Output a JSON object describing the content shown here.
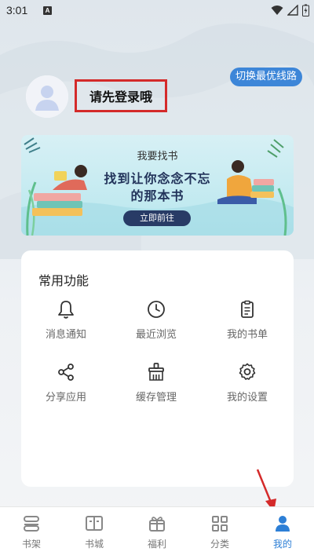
{
  "status_bar": {
    "time": "3:01",
    "notification_letter": "A"
  },
  "header": {
    "switch_line_label": "切换最优线路",
    "login_hint": "请先登录哦"
  },
  "banner": {
    "title": "我要找书",
    "slogan_line1": "找到让你念念不忘",
    "slogan_line2": "的那本书",
    "button_label": "立即前往"
  },
  "functions": {
    "title": "常用功能",
    "items": [
      {
        "label": "消息通知",
        "icon": "bell-icon"
      },
      {
        "label": "最近浏览",
        "icon": "clock-icon"
      },
      {
        "label": "我的书单",
        "icon": "clipboard-icon"
      },
      {
        "label": "分享应用",
        "icon": "share-icon"
      },
      {
        "label": "缓存管理",
        "icon": "broom-icon"
      },
      {
        "label": "我的设置",
        "icon": "gear-icon"
      }
    ]
  },
  "tabs": [
    {
      "label": "书架",
      "icon": "bookshelf-icon"
    },
    {
      "label": "书城",
      "icon": "book-icon"
    },
    {
      "label": "福利",
      "icon": "gift-icon"
    },
    {
      "label": "分类",
      "icon": "grid-icon"
    },
    {
      "label": "我的",
      "icon": "user-icon",
      "active": true
    }
  ],
  "colors": {
    "accent": "#2d7fd6",
    "switch_pill": "#3d86d8",
    "highlight_box": "#d42a2a"
  }
}
